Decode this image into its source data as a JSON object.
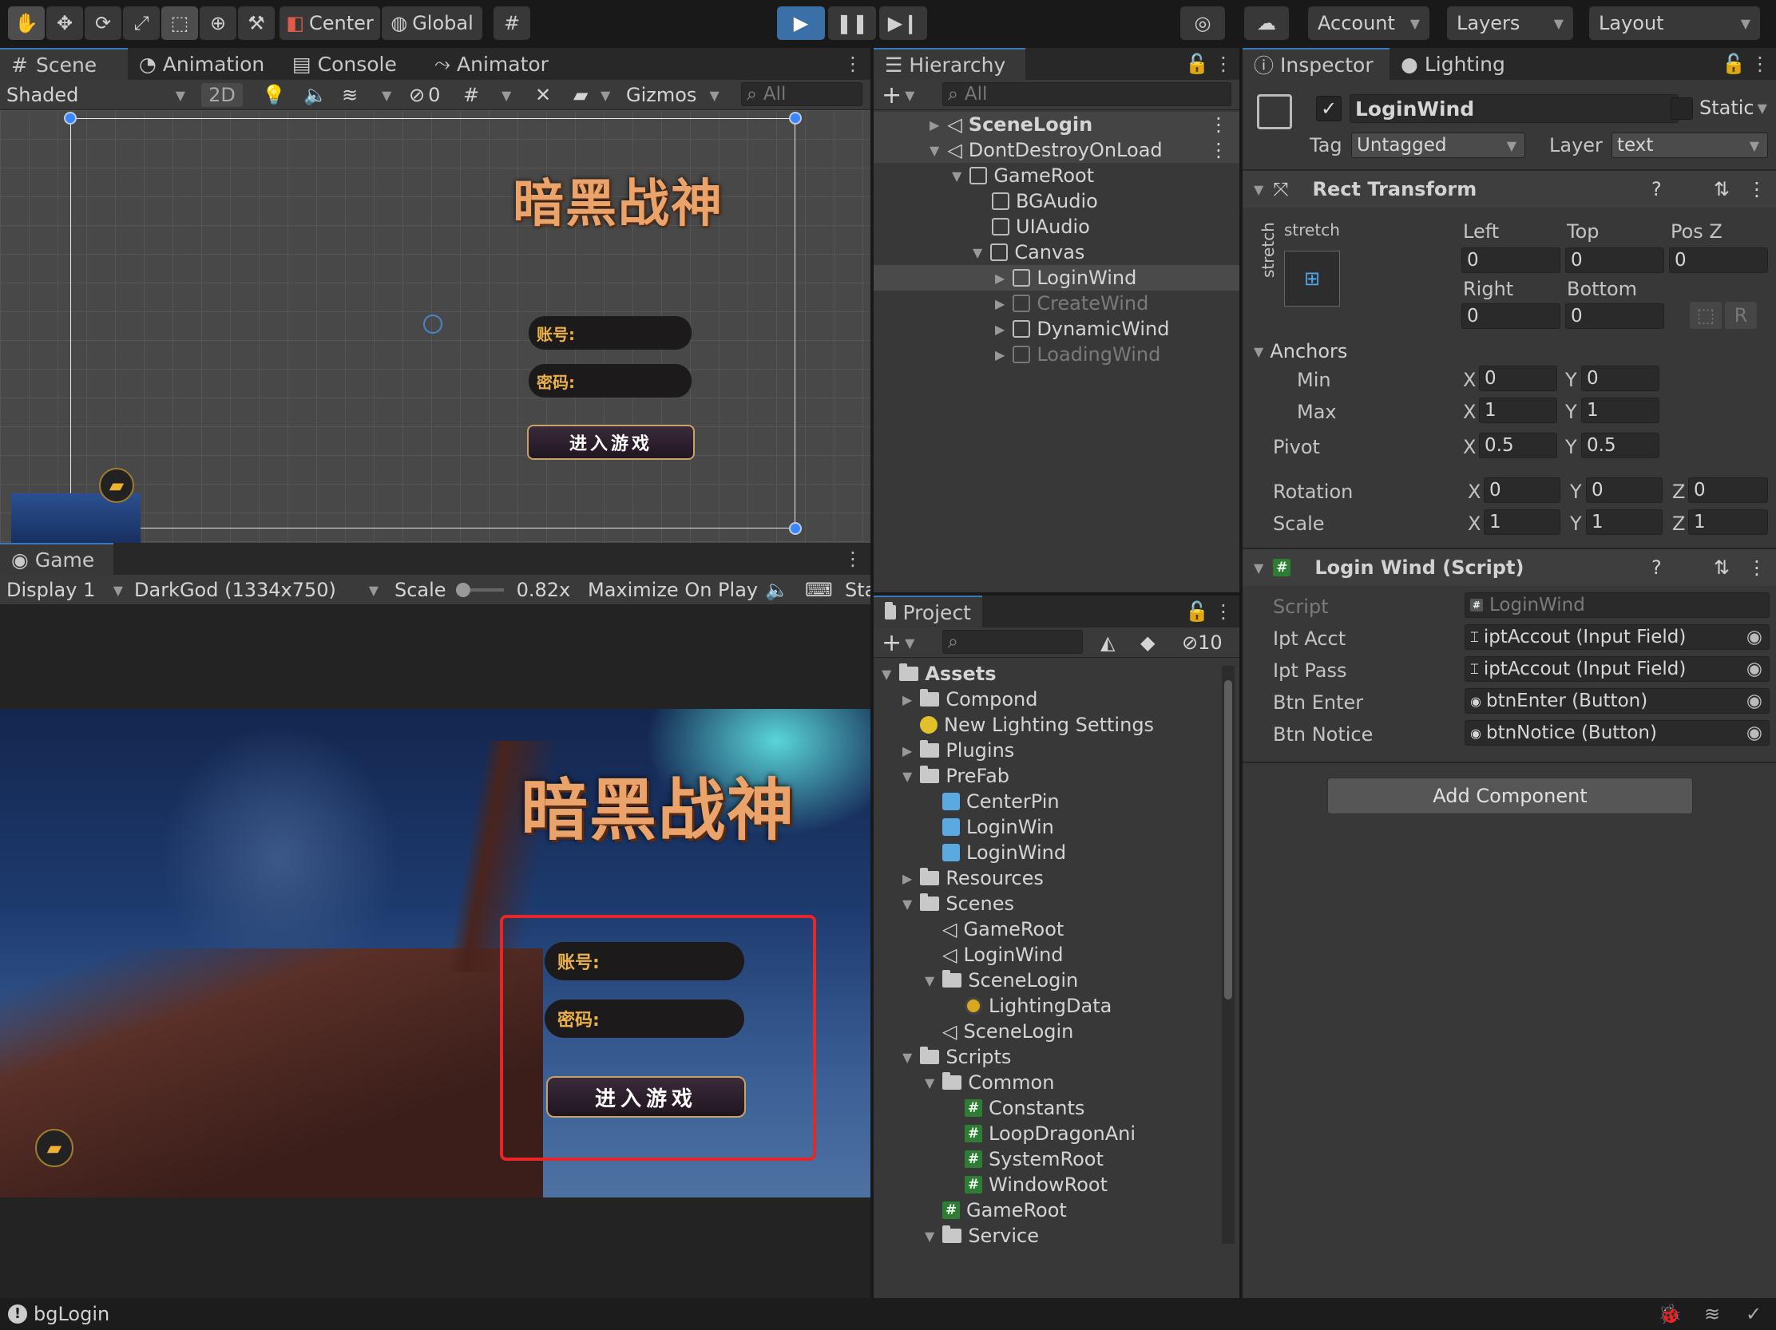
{
  "toolbar": {
    "center": "Center",
    "global": "Global",
    "account": "Account",
    "layers": "Layers",
    "layout": "Layout"
  },
  "scene": {
    "tabs": [
      "Scene",
      "Animation",
      "Console",
      "Animator"
    ],
    "shading": "Shaded",
    "mode2d": "2D",
    "hidden_count": "0",
    "gizmos": "Gizmos",
    "search_placeholder": "All"
  },
  "game_view": {
    "tab": "Game",
    "display": "Display 1",
    "resolution": "DarkGod (1334x750)",
    "scale_label": "Scale",
    "scale_value": "0.82x",
    "maximize": "Maximize On Play",
    "stats": "Sta"
  },
  "login_ui": {
    "logo": "暗黑战神",
    "account_label": "账号:",
    "password_label": "密码:",
    "enter_button": "进入游戏"
  },
  "hierarchy": {
    "tab": "Hierarchy",
    "search_placeholder": "All",
    "items": [
      {
        "label": "SceneLogin",
        "depth": 0,
        "bold": true
      },
      {
        "label": "DontDestroyOnLoad",
        "depth": 0
      },
      {
        "label": "GameRoot",
        "depth": 1
      },
      {
        "label": "BGAudio",
        "depth": 2
      },
      {
        "label": "UIAudio",
        "depth": 2
      },
      {
        "label": "Canvas",
        "depth": 2
      },
      {
        "label": "LoginWind",
        "depth": 3
      },
      {
        "label": "CreateWind",
        "depth": 3,
        "dim": true
      },
      {
        "label": "DynamicWind",
        "depth": 3
      },
      {
        "label": "LoadingWind",
        "depth": 3,
        "dim": true
      }
    ]
  },
  "project": {
    "tab": "Project",
    "hidden_count": "10",
    "items": [
      {
        "label": "Assets",
        "depth": 0,
        "icon": "folder",
        "bold": true
      },
      {
        "label": "Compond",
        "depth": 1,
        "icon": "folder"
      },
      {
        "label": "New Lighting Settings",
        "depth": 1,
        "icon": "light"
      },
      {
        "label": "Plugins",
        "depth": 1,
        "icon": "folder"
      },
      {
        "label": "PreFab",
        "depth": 1,
        "icon": "folder"
      },
      {
        "label": "CenterPin",
        "depth": 2,
        "icon": "prefab"
      },
      {
        "label": "LoginWin",
        "depth": 2,
        "icon": "prefab"
      },
      {
        "label": "LoginWind",
        "depth": 2,
        "icon": "prefab"
      },
      {
        "label": "Resources",
        "depth": 1,
        "icon": "folder"
      },
      {
        "label": "Scenes",
        "depth": 1,
        "icon": "folder"
      },
      {
        "label": "GameRoot",
        "depth": 2,
        "icon": "unity"
      },
      {
        "label": "LoginWind",
        "depth": 2,
        "icon": "unity"
      },
      {
        "label": "SceneLogin",
        "depth": 2,
        "icon": "folder"
      },
      {
        "label": "LightingData",
        "depth": 3,
        "icon": "light"
      },
      {
        "label": "SceneLogin",
        "depth": 2,
        "icon": "unity"
      },
      {
        "label": "Scripts",
        "depth": 1,
        "icon": "folder"
      },
      {
        "label": "Common",
        "depth": 2,
        "icon": "folder"
      },
      {
        "label": "Constants",
        "depth": 3,
        "icon": "script"
      },
      {
        "label": "LoopDragonAni",
        "depth": 3,
        "icon": "script"
      },
      {
        "label": "SystemRoot",
        "depth": 3,
        "icon": "script"
      },
      {
        "label": "WindowRoot",
        "depth": 3,
        "icon": "script"
      },
      {
        "label": "GameRoot",
        "depth": 2,
        "icon": "script"
      },
      {
        "label": "Service",
        "depth": 2,
        "icon": "folder"
      }
    ]
  },
  "inspector": {
    "tabs": [
      "Inspector",
      "Lighting"
    ],
    "object_name": "LoginWind",
    "static_label": "Static",
    "tag_label": "Tag",
    "tag_value": "Untagged",
    "layer_label": "Layer",
    "layer_value": "text",
    "rect": {
      "title": "Rect Transform",
      "stretch_h": "stretch",
      "stretch_v": "stretch",
      "left_label": "Left",
      "top_label": "Top",
      "posz_label": "Pos Z",
      "left": "0",
      "top": "0",
      "posz": "0",
      "right_label": "Right",
      "bottom_label": "Bottom",
      "right": "0",
      "bottom": "0",
      "r_btn": "R",
      "anchors": "Anchors",
      "min": "Min",
      "max": "Max",
      "min_x": "0",
      "min_y": "0",
      "max_x": "1",
      "max_y": "1",
      "pivot": "Pivot",
      "pivot_x": "0.5",
      "pivot_y": "0.5",
      "rotation": "Rotation",
      "rot_x": "0",
      "rot_y": "0",
      "rot_z": "0",
      "scale": "Scale",
      "scale_x": "1",
      "scale_y": "1",
      "scale_z": "1",
      "x": "X",
      "y": "Y",
      "z": "Z"
    },
    "script": {
      "title": "Login Wind (Script)",
      "rows": [
        {
          "label": "Script",
          "value": "LoginWind"
        },
        {
          "label": "Ipt Acct",
          "value": "iptAccout (Input Field)"
        },
        {
          "label": "Ipt Pass",
          "value": "iptAccout (Input Field)"
        },
        {
          "label": "Btn Enter",
          "value": "btnEnter (Button)"
        },
        {
          "label": "Btn Notice",
          "value": "btnNotice (Button)"
        }
      ]
    },
    "add_component": "Add Component"
  },
  "status": {
    "message": "bgLogin"
  }
}
